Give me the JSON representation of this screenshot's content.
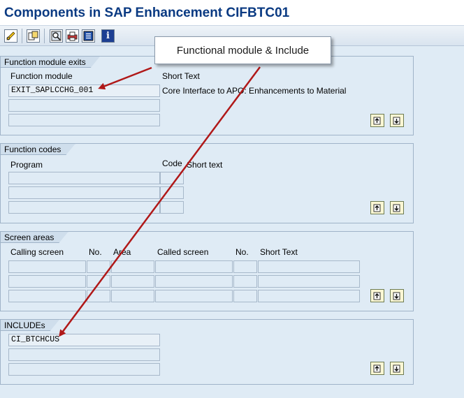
{
  "title": "Components in SAP Enhancement CIFBTC01",
  "toolbar": {
    "buttons": [
      {
        "icon": "pencil-glasses-icon"
      },
      {
        "icon": "object-list-icon"
      },
      {
        "icon": "find-icon"
      },
      {
        "icon": "print-icon"
      },
      {
        "icon": "list-icon"
      },
      {
        "icon": "info-icon",
        "glyph": "i"
      }
    ]
  },
  "callout": {
    "text": "Functional module & Include"
  },
  "function_module_exits": {
    "title": "Function module exits",
    "col_function_module": "Function module",
    "col_short_text": "Short Text",
    "rows": [
      {
        "function_module": "EXIT_SAPLCCHG_001",
        "short_text": "Core Interface to APO: Enhancements to Material"
      },
      {
        "function_module": "",
        "short_text": ""
      },
      {
        "function_module": "",
        "short_text": ""
      }
    ]
  },
  "function_codes": {
    "title": "Function codes",
    "col_program": "Program",
    "col_code": "Code",
    "col_short_text": "Short text"
  },
  "screen_areas": {
    "title": "Screen areas",
    "col_calling_screen": "Calling screen",
    "col_no1": "No.",
    "col_area": "Area",
    "col_called_screen": "Called screen",
    "col_no2": "No.",
    "col_short_text": "Short Text"
  },
  "includes": {
    "title": "INCLUDEs",
    "rows": [
      "CI_BTCHCUS",
      "",
      ""
    ]
  },
  "colors": {
    "background": "#dfebf5",
    "title_text": "#0a3a82",
    "arrow": "#b01818"
  }
}
